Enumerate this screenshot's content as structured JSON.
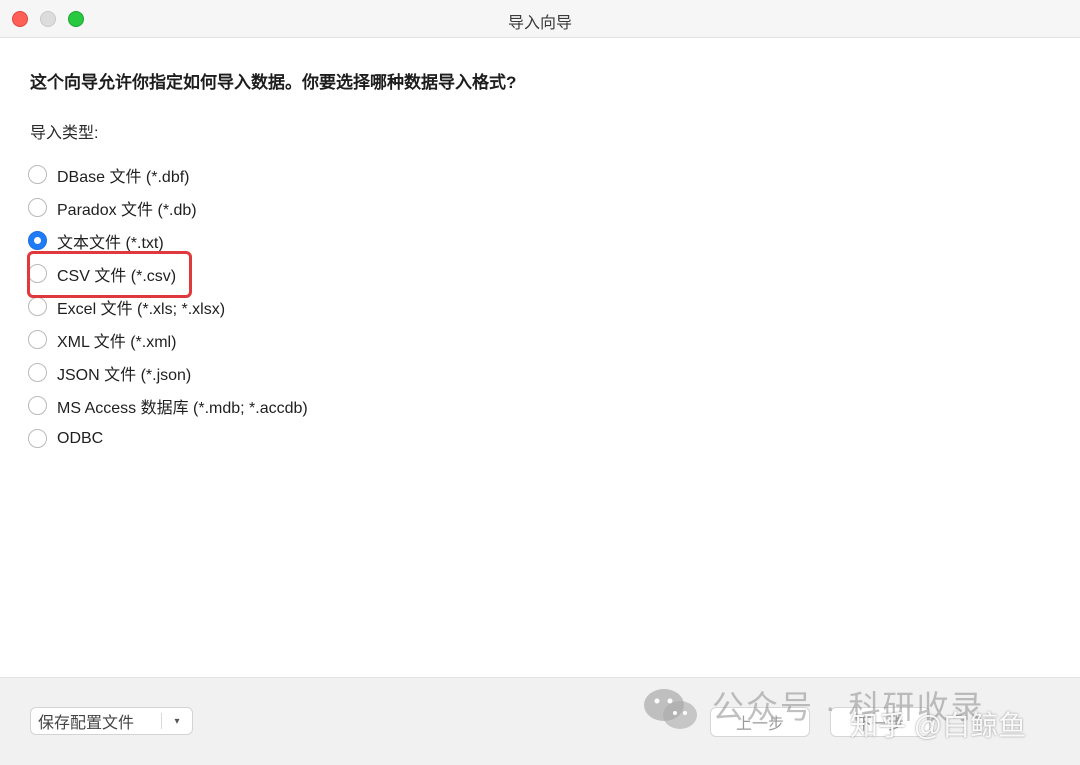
{
  "window": {
    "title": "导入向导"
  },
  "content": {
    "question": "这个向导允许你指定如何导入数据。你要选择哪种数据导入格式?",
    "type_label": "导入类型:",
    "options": [
      {
        "label": "DBase 文件 (*.dbf)",
        "selected": false
      },
      {
        "label": "Paradox 文件 (*.db)",
        "selected": false
      },
      {
        "label": "文本文件 (*.txt)",
        "selected": true
      },
      {
        "label": "CSV 文件 (*.csv)",
        "selected": false
      },
      {
        "label": "Excel 文件 (*.xls; *.xlsx)",
        "selected": false
      },
      {
        "label": "XML 文件 (*.xml)",
        "selected": false
      },
      {
        "label": "JSON 文件 (*.json)",
        "selected": false
      },
      {
        "label": "MS Access 数据库 (*.mdb; *.accdb)",
        "selected": false
      },
      {
        "label": "ODBC",
        "selected": false
      }
    ],
    "highlight_color": "#e0393d",
    "accent_color": "#1f7bf6"
  },
  "footer": {
    "save_config_label": "保存配置文件",
    "save_config_arrow": "▾",
    "prev_label": "上一步",
    "next_label": "下一步"
  },
  "watermark": {
    "line1": "公众号 · 科研收录",
    "line2": "知乎 @白鲸鱼",
    "icon": "wechat-icon"
  }
}
